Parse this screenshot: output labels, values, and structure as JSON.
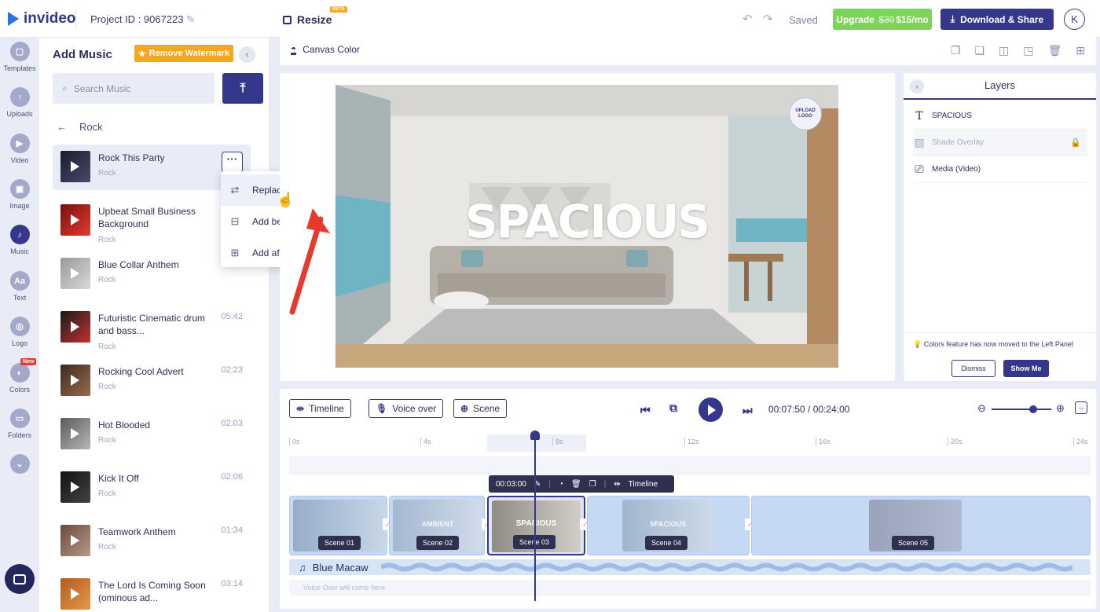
{
  "header": {
    "logo": "invideo",
    "project_id": "Project ID : 9067223",
    "resize_label": "Resize",
    "beta_badge": "BETA",
    "saved_status": "Saved",
    "upgrade_label": "Upgrade",
    "upgrade_old_price": "$30",
    "upgrade_price": "$15/mo",
    "download_label": "Download & Share",
    "avatar_letter": "K"
  },
  "rail": [
    {
      "label": "Templates",
      "icon": "template-icon"
    },
    {
      "label": "Uploads",
      "icon": "upload-icon"
    },
    {
      "label": "Video",
      "icon": "video-icon"
    },
    {
      "label": "Image",
      "icon": "image-icon"
    },
    {
      "label": "Music",
      "icon": "music-icon",
      "active": true
    },
    {
      "label": "Text",
      "icon": "text-icon",
      "glyph": "Aa"
    },
    {
      "label": "Logo",
      "icon": "logo-icon"
    },
    {
      "label": "Colors",
      "icon": "colors-icon",
      "badge": "New"
    },
    {
      "label": "Folders",
      "icon": "folder-icon"
    }
  ],
  "music_panel": {
    "title": "Add Music",
    "watermark_button": "Remove Watermark",
    "search_placeholder": "Search Music",
    "category": "Rock",
    "tracks": [
      {
        "name": "Rock This Party",
        "genre": "Rock",
        "duration": ""
      },
      {
        "name": "Upbeat Small Business Background",
        "genre": "Rock",
        "duration": ""
      },
      {
        "name": "Blue Collar Anthem",
        "genre": "Rock",
        "duration": ""
      },
      {
        "name": "Futuristic Cinematic drum and bass...",
        "genre": "Rock",
        "duration": "05:42"
      },
      {
        "name": "Rocking Cool Advert",
        "genre": "Rock",
        "duration": "02:23"
      },
      {
        "name": "Hot Blooded",
        "genre": "Rock",
        "duration": "02:03"
      },
      {
        "name": "Kick It Off",
        "genre": "Rock",
        "duration": "02:06"
      },
      {
        "name": "Teamwork Anthem",
        "genre": "Rock",
        "duration": "01:34"
      },
      {
        "name": "The Lord Is Coming Soon (ominous ad...",
        "genre": "Rock",
        "duration": "03:14"
      }
    ],
    "context_menu": [
      "Replace music",
      "Add before track",
      "Add after track"
    ]
  },
  "canvas": {
    "canvas_color_label": "Canvas Color",
    "upload_logo": "UPLOAD LOGO",
    "headline": "SPACIOUS"
  },
  "layers": {
    "title": "Layers",
    "items": [
      {
        "label": "SPACIOUS",
        "icon": "text-layer-icon"
      },
      {
        "label": "Shade Overlay",
        "icon": "overlay-layer-icon",
        "locked": true
      },
      {
        "label": "Media (Video)",
        "icon": "video-layer-icon"
      }
    ],
    "notice": "Colors feature has now moved to the Left Panel",
    "dismiss": "Dismiss",
    "show_me": "Show Me"
  },
  "timeline": {
    "timeline_btn": "Timeline",
    "voiceover_btn": "Voice over",
    "scene_btn": "Scene",
    "current_time": "00:07:50",
    "total_time": "00:24:00",
    "ruler_ticks": [
      "0s",
      "4s",
      "8s",
      "12s",
      "16s",
      "20s",
      "24s"
    ],
    "scene_toolbar_time": "00:03:00",
    "scene_toolbar_timeline": "Timeline",
    "scenes": [
      "Scene 01",
      "Scene 02",
      "Scene 03",
      "Scene 04",
      "Scene 05"
    ],
    "scene_thumb_texts": [
      "",
      "AMBIENT",
      "SPACIOUS",
      "SPACIOUS",
      ""
    ],
    "audio_track": "Blue Macaw",
    "voiceover_placeholder": "Voice Over will come here",
    "zoom_level": 0.7
  },
  "colors": {
    "primary": "#35378a",
    "upgrade_green": "#7ed35a",
    "watermark_orange": "#f7a622",
    "arrow_red": "#e8392e"
  }
}
